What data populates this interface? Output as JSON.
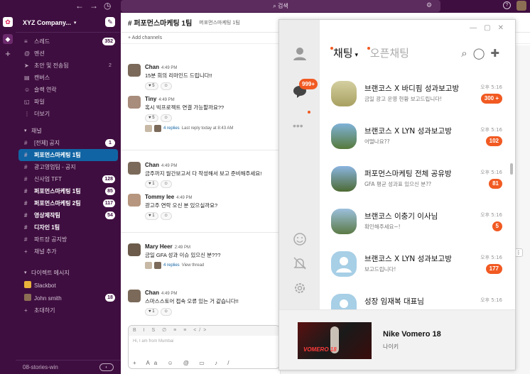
{
  "topbar": {
    "search_placeholder": "검색",
    "back": "←",
    "forward": "→",
    "history": "◷",
    "help": "?"
  },
  "workspace": {
    "name": "XYZ Company...",
    "items": [
      {
        "icon": "≡",
        "label": "스레드",
        "count": "352"
      },
      {
        "icon": "@",
        "label": "멘션",
        "count": ""
      },
      {
        "icon": "➤",
        "label": "초안 및 전송됨",
        "count": "2"
      },
      {
        "icon": "▤",
        "label": "캔버스",
        "count": ""
      },
      {
        "icon": "☺",
        "label": "슬랙 연락",
        "count": ""
      },
      {
        "icon": "◱",
        "label": "파일",
        "count": ""
      },
      {
        "icon": "⋮",
        "label": "더보기",
        "count": ""
      }
    ],
    "channels_header": "채널",
    "channels": [
      {
        "label": "[전체] 공지",
        "count": "1",
        "bold": false,
        "active": false
      },
      {
        "label": "퍼포먼스마케팅 1팀",
        "count": "",
        "bold": true,
        "active": true
      },
      {
        "label": "광고영업팀 - 공지",
        "count": "",
        "bold": false,
        "active": false
      },
      {
        "label": "신사업 TFT",
        "count": "128",
        "bold": false,
        "active": false
      },
      {
        "label": "퍼포먼스마케팅 1팀",
        "count": "85",
        "bold": true,
        "active": false
      },
      {
        "label": "퍼포먼스마케팅 2팀",
        "count": "117",
        "bold": true,
        "active": false
      },
      {
        "label": "영상제작팀",
        "count": "54",
        "bold": true,
        "active": false
      },
      {
        "label": "디자인 1팀",
        "count": "",
        "bold": true,
        "active": false
      },
      {
        "label": "파트장 공지방",
        "count": "",
        "bold": false,
        "active": false
      }
    ],
    "add_channel": "채널 추가",
    "dm_header": "다이렉트 메시지",
    "dms": [
      {
        "label": "Slackbot",
        "count": ""
      },
      {
        "label": "John smith",
        "count": "18"
      }
    ],
    "invite": "초대하기",
    "footer": "08-stories-win"
  },
  "channel": {
    "title": "# 퍼포먼스마케팅 1팀",
    "topic": "퍼포먼스마케팅 1팀",
    "add_channels": "+ Add channels",
    "messages": [
      {
        "name": "Chan",
        "time": "4:49 PM",
        "text": "15분 회의 리마인드 드립니다!!",
        "reacts": [
          "♥ 5",
          "☺"
        ],
        "thread": ""
      },
      {
        "name": "Tiny",
        "time": "4:49 PM",
        "text": "혹시 빅프로젝트 연결 가능할까요??",
        "reacts": [
          "♥ 5",
          "☺"
        ],
        "thread": "4 replies",
        "thread_sub": "Last reply today at 8:43 AM"
      },
      {
        "name": "Chan",
        "time": "4:49 PM",
        "text": "금주까지 월간보고서 다 작성해서 보고 준비해주세요!",
        "reacts": [
          "♥ 1",
          "☺"
        ],
        "thread": ""
      },
      {
        "name": "Tommy lee",
        "time": "4:49 PM",
        "text": "광고주 연락 오신 분 있으실까요?",
        "reacts": [
          "♥ 1",
          "☺"
        ],
        "thread": ""
      },
      {
        "name": "Mary Heer",
        "time": "2:49 PM",
        "text": "금일 GFA 성과 이슈 있으신 분???",
        "reacts": [],
        "thread": "4 replies",
        "thread_sub": "View thread"
      },
      {
        "name": "Chan",
        "time": "4:49 PM",
        "text": "스마스스토어 접속 오류 있는 거 같습니다!!",
        "reacts": [
          "♥ 1",
          "☺"
        ],
        "thread": ""
      }
    ],
    "composer_placeholder": "Hi, I am from Mumbai",
    "composer_format": "B I S ∅ ≡ ≡ </>",
    "composer_tools": "+ Aa ☺ @ ▭ ♪ /"
  },
  "kakao": {
    "tab_chat": "채팅",
    "tab_open": "오픈채팅",
    "badge": "999+",
    "rows": [
      {
        "title": "브랜코스 X 바디핌 성과보고방",
        "sub": "금일 광고 운영 현황 보고드립니다!",
        "time": "오후 5:16",
        "count": "300 +"
      },
      {
        "title": "브랜코스 X LYN 성과보고방",
        "sub": "어떨나요??",
        "time": "오후 5:16",
        "count": "102"
      },
      {
        "title": "퍼포먼스마케팅 전체 공유방",
        "sub": "GFA 평균 성과표 있으신 분??",
        "time": "오후 5:16",
        "count": "81"
      },
      {
        "title": "브랜코스 이충기 이사님",
        "sub": "확인해주세요~!",
        "time": "오후 5:16",
        "count": "5"
      },
      {
        "title": "브랜코스 X LYN 성과보고방",
        "sub": "보고드립니다!",
        "time": "오후 5:16",
        "count": "177"
      },
      {
        "title": "성장 임재복 대표님",
        "sub": "",
        "time": "오후 5:16",
        "count": ""
      }
    ],
    "ad": {
      "title": "Nike Vomero 18",
      "brand": "나이키",
      "image_text": "VOMERO 18"
    }
  },
  "colors": {
    "slack_aubergine": "#3f0e40",
    "slack_active": "#1164a3",
    "kakao_badge": "#f15a22"
  }
}
